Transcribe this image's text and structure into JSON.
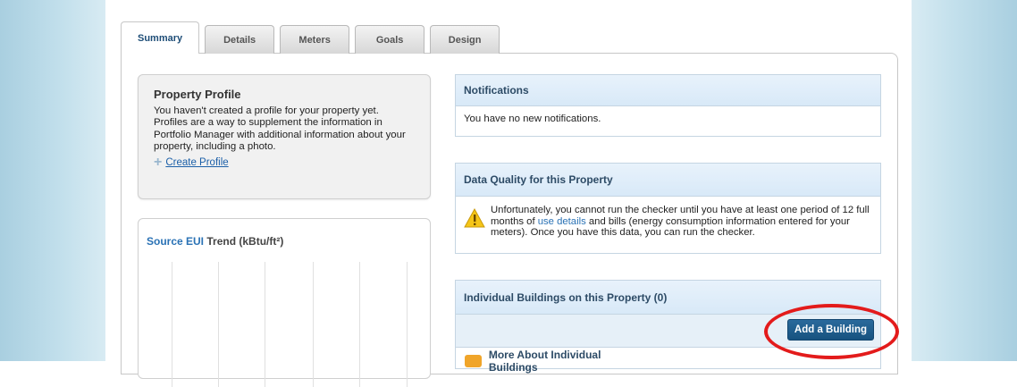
{
  "tabs": [
    {
      "label": "Summary",
      "active": true
    },
    {
      "label": "Details",
      "active": false
    },
    {
      "label": "Meters",
      "active": false
    },
    {
      "label": "Goals",
      "active": false
    },
    {
      "label": "Design",
      "active": false
    }
  ],
  "profile": {
    "title": "Property Profile",
    "text": "You haven't created a profile for your property yet. Profiles are a way to supplement the information in Portfolio Manager with additional information about your property, including a photo.",
    "create_link": "Create Profile"
  },
  "eui": {
    "title_link": "Source EUI",
    "title_rest": " Trend (kBtu/ft²)"
  },
  "notifications": {
    "title": "Notifications",
    "message": "You have no new notifications."
  },
  "data_quality": {
    "title": "Data Quality for this Property",
    "text_before": "Unfortunately, you cannot run the checker until you have at least one period of 12 full months of ",
    "link": "use details",
    "text_after": " and bills (energy consumption information entered for your meters). Once you have this data, you can run the checker."
  },
  "buildings": {
    "title": "Individual Buildings on this Property (0)",
    "add_button": "Add a Building",
    "more_label": "More About Individual Buildings"
  },
  "colors": {
    "accent_blue": "#2a72b5",
    "button_blue": "#17527f",
    "highlight_red": "#e31b1b",
    "warning_yellow": "#f5c518"
  }
}
